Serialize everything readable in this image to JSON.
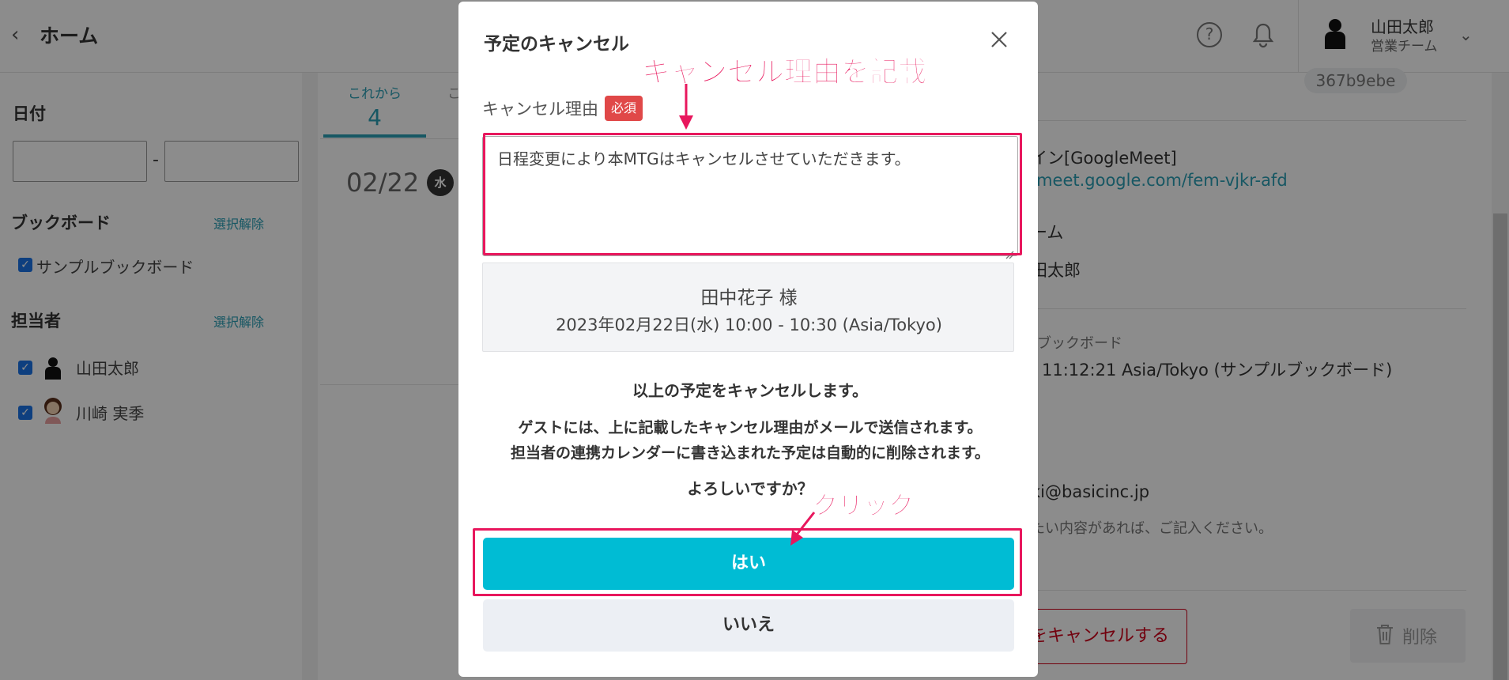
{
  "header": {
    "title": "ホーム",
    "user_name": "山田太郎",
    "user_team": "営業チーム"
  },
  "sidebar": {
    "date_heading": "日付",
    "date_separator": "-",
    "bookboard_heading": "ブックボード",
    "bookboard_clear": "選択解除",
    "bookboard_item": "サンプルブックボード",
    "assignee_heading": "担当者",
    "assignee_clear": "選択解除",
    "assignees": [
      "山田太郎",
      "川崎 実季"
    ]
  },
  "main": {
    "tab_upcoming_label": "これから",
    "tab_upcoming_count": "4",
    "tab_next_partial": "こ",
    "date": "02/22",
    "weekday": "水"
  },
  "detail": {
    "id_badge": "367b9ebe",
    "paren": ")",
    "meeting_type": "イン[GoogleMeet]",
    "meeting_url": "/meet.google.com/fem-vjkr-afd",
    "team": "ーム",
    "owner": "田太郎",
    "bookboard_label": "ブックボード",
    "created": "11:12:21 Asia/Tokyo (サンプルブックボード)",
    "email": "ki@basicinc.jp",
    "note": "たい内容があれば、ご記入ください。",
    "cancel_button": "をキャンセルする",
    "delete_button": "削除"
  },
  "modal": {
    "title": "予定のキャンセル",
    "reason_label": "キャンセル理由",
    "required_badge": "必須",
    "reason_value": "日程変更により本MTGはキャンセルさせていただきます。",
    "guest_name": "田中花子 様",
    "schedule": "2023年02月22日(水) 10:00 - 10:30 (Asia/Tokyo)",
    "message_1": "以上の予定をキャンセルします。",
    "message_2": "ゲストには、上に記載したキャンセル理由がメールで送信されます。",
    "message_3": "担当者の連携カレンダーに書き込まれた予定は自動的に削除されます。",
    "confirm_question": "よろしいですか？",
    "yes_button": "はい",
    "no_button": "いいえ"
  },
  "annotations": {
    "reason_note": "キャンセル理由を記載",
    "click_note": "クリック",
    "color": "#e8175d"
  },
  "colors": {
    "accent": "#00bcd4",
    "link": "#2a9fb5",
    "danger": "#d0021b",
    "required": "#e04848"
  }
}
